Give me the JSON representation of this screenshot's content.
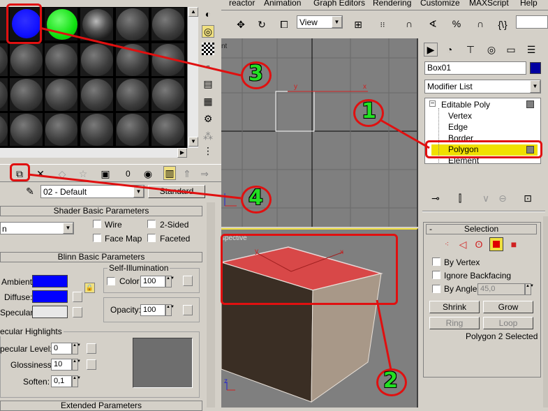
{
  "menu": {
    "items": [
      "reactor",
      "Animation",
      "Graph Editors",
      "Rendering",
      "Customize",
      "MAXScript",
      "Help"
    ]
  },
  "toolbar": {
    "view_dropdown": "View"
  },
  "viewports": {
    "top_label": "nt",
    "persp_label": "spective",
    "axis_x": "x",
    "axis_y": "y",
    "axis_z": "z"
  },
  "command_panel": {
    "object_name": "Box01",
    "object_color": "#0000a0",
    "modifier_list": "Modifier List",
    "stack": [
      "Editable Poly",
      "Vertex",
      "Edge",
      "Border",
      "Polygon",
      "Element"
    ],
    "selected_sub": "Polygon"
  },
  "selection": {
    "title": "Selection",
    "toggle": "-",
    "by_vertex": "By Vertex",
    "ignore_backfacing": "Ignore Backfacing",
    "by_angle": "By Angle:",
    "angle_value": "45,0",
    "shrink": "Shrink",
    "grow": "Grow",
    "ring": "Ring",
    "loop": "Loop",
    "status": "Polygon 2 Selected"
  },
  "material_editor": {
    "material_name": "02 - Default",
    "material_type": "Standard",
    "shader_title": "Shader Basic Parameters",
    "shader_type": "n",
    "wire": "Wire",
    "two_sided": "2-Sided",
    "face_map": "Face Map",
    "faceted": "Faceted",
    "blinn_title": "Blinn Basic Parameters",
    "self_illum": "Self-Illumination",
    "color_label": "Color",
    "color_value": "100",
    "opacity_label": "Opacity:",
    "opacity_value": "100",
    "ambient": "Ambient:",
    "diffuse": "Diffuse:",
    "specular": "Specular:",
    "ambient_color": "#0000ff",
    "diffuse_color": "#0000ff",
    "specular_color": "#e8e8e8",
    "highlights_title": "ecular Highlights",
    "spec_level": "pecular Level:",
    "spec_level_value": "0",
    "glossiness": "Glossiness:",
    "glossiness_value": "10",
    "soften": "Soften:",
    "soften_value": "0,1",
    "extended_title": "Extended Parameters",
    "toolbar_value": "0"
  },
  "annotations": {
    "one": "1",
    "two": "2",
    "three": "3",
    "four": "4",
    "color": "#e01010",
    "number_color": "#22e022"
  }
}
